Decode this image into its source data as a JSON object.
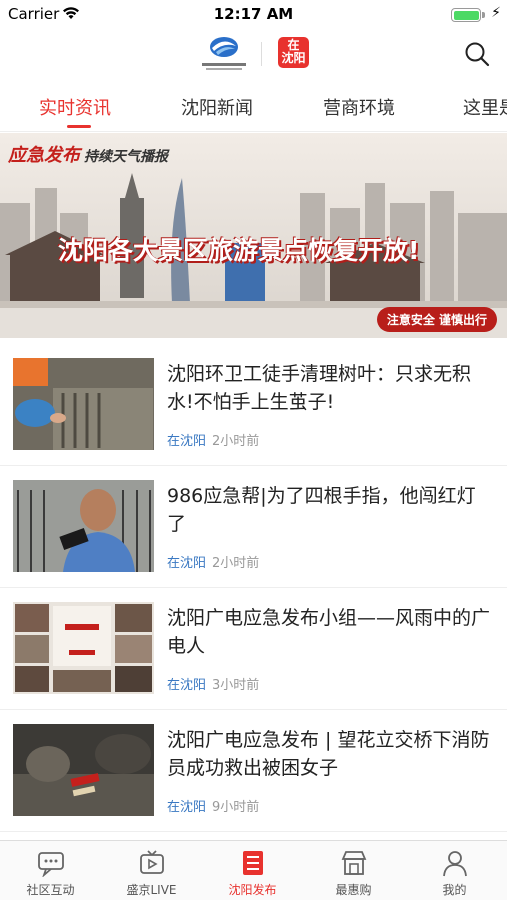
{
  "status_bar": {
    "carrier": "Carrier",
    "time": "12:17 AM",
    "battery_level": 1.0
  },
  "header": {
    "logo_left_icon": "station-logo-icon",
    "logo_right_text_line1": "在",
    "logo_right_text_line2": "沈阳",
    "search_icon": "search-icon"
  },
  "tabs": [
    {
      "label": "实时资讯",
      "active": true
    },
    {
      "label": "沈阳新闻",
      "active": false
    },
    {
      "label": "营商环境",
      "active": false
    },
    {
      "label": "这里是",
      "active": false
    }
  ],
  "banner": {
    "brand": "应急发布",
    "brand_sub": "持续天气播报",
    "headline": "沈阳各大景区旅游景点恢复开放!",
    "tagline": "注意安全  谨慎出行"
  },
  "news": [
    {
      "title": "沈阳环卫工徒手清理树叶：只求无积水!不怕手上生茧子!",
      "source": "在沈阳",
      "time": "2小时前"
    },
    {
      "title": "986应急帮|为了四根手指，他闯红灯了",
      "source": "在沈阳",
      "time": "2小时前"
    },
    {
      "title": "沈阳广电应急发布小组——风雨中的广电人",
      "source": "在沈阳",
      "time": "3小时前"
    },
    {
      "title": "沈阳广电应急发布 | 望花立交桥下消防员成功救出被困女子",
      "source": "在沈阳",
      "time": "9小时前"
    }
  ],
  "bottom_nav": [
    {
      "label": "社区互动",
      "icon": "chat-bubble-icon",
      "active": false
    },
    {
      "label": "盛京LIVE",
      "icon": "tv-play-icon",
      "active": false
    },
    {
      "label": "沈阳发布",
      "icon": "news-list-icon",
      "active": true
    },
    {
      "label": "最惠购",
      "icon": "shop-icon",
      "active": false
    },
    {
      "label": "我的",
      "icon": "person-icon",
      "active": false
    }
  ],
  "colors": {
    "accent": "#e8322e",
    "source_blue": "#3a78c2",
    "meta_gray": "#999999"
  }
}
